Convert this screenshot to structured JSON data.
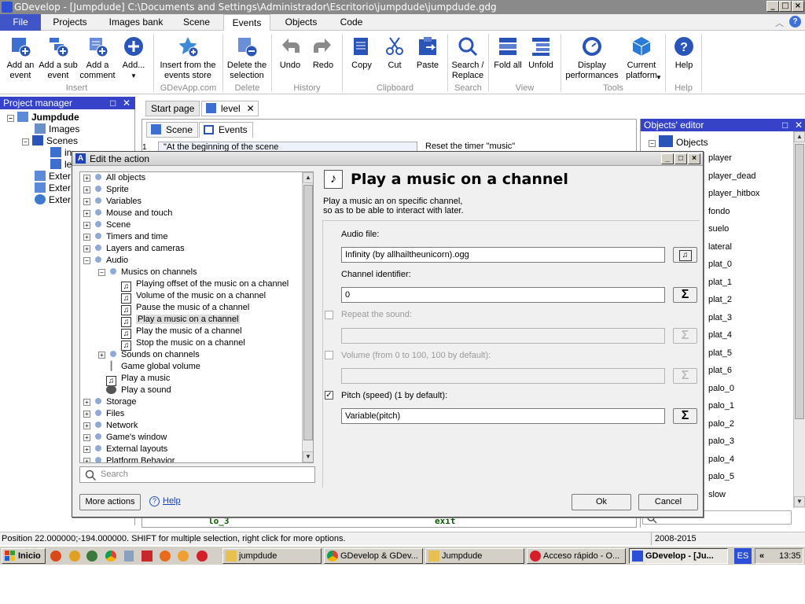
{
  "window": {
    "title": "GDevelop - [Jumpdude] C:\\Documents and Settings\\Administrador\\Escritorio\\jumpdude\\jumpdude.gdg"
  },
  "ribbon_tabs": [
    "File",
    "Projects",
    "Images bank",
    "Scene",
    "Events",
    "Objects",
    "Code"
  ],
  "ribbon": {
    "buttons": [
      {
        "label": "Add an\nevent",
        "icon": "add-event-icon"
      },
      {
        "label": "Add a sub\nevent",
        "icon": "add-subevent-icon"
      },
      {
        "label": "Add a\ncomment",
        "icon": "add-comment-icon"
      },
      {
        "label": "Add...",
        "icon": "add-plus-icon"
      },
      {
        "label": "Insert from the\nevents store",
        "icon": "events-store-icon"
      },
      {
        "label": "Delete the\nselection",
        "icon": "delete-selection-icon"
      },
      {
        "label": "Undo",
        "icon": "undo-icon"
      },
      {
        "label": "Redo",
        "icon": "redo-icon"
      },
      {
        "label": "Copy",
        "icon": "copy-icon"
      },
      {
        "label": "Cut",
        "icon": "cut-icon"
      },
      {
        "label": "Paste",
        "icon": "paste-icon"
      },
      {
        "label": "Search /\nReplace",
        "icon": "search-icon"
      },
      {
        "label": "Fold all",
        "icon": "fold-all-icon"
      },
      {
        "label": "Unfold",
        "icon": "unfold-icon"
      },
      {
        "label": "Display\nperformances",
        "icon": "performance-icon"
      },
      {
        "label": "Current\nplatform",
        "icon": "platform-icon"
      },
      {
        "label": "Help",
        "icon": "help-icon"
      }
    ],
    "groups": [
      "Insert",
      "GDevApp.com",
      "Delete",
      "History",
      "Clipboard",
      "Search",
      "View",
      "Tools",
      "Help"
    ]
  },
  "project_manager": {
    "title": "Project manager",
    "tree": [
      "Jumpdude",
      "Images",
      "Scenes",
      "in",
      "le",
      "Exter",
      "Exter",
      "Exter"
    ]
  },
  "editor_tabs": [
    "Start page",
    "level"
  ],
  "sub_tabs": [
    "Scene",
    "Events"
  ],
  "events_fragments": [
    "1",
    "\"At the beginning of the scene",
    "Reset the timer \"music\"",
    "lo_3",
    "exit"
  ],
  "objects_editor": {
    "title": "Objects' editor",
    "root": "Objects",
    "items": [
      "player",
      "player_dead",
      "player_hitbox",
      "fondo",
      "suelo",
      "lateral",
      "plat_0",
      "plat_1",
      "plat_2",
      "plat_3",
      "plat_4",
      "plat_5",
      "plat_6",
      "palo_0",
      "palo_1",
      "palo_2",
      "palo_3",
      "palo_4",
      "palo_5",
      "slow"
    ]
  },
  "dialog": {
    "title": "Edit the action",
    "action_title": "Play a music on a channel",
    "description": "Play a music an on specific channel,\nso as to be able to interact with later.",
    "tree": [
      "All objects",
      "Sprite",
      "Variables",
      "Mouse and touch",
      "Scene",
      "Timers and time",
      "Layers and cameras",
      "Audio",
      "Musics on channels",
      "Playing offset of the music on a channel",
      "Volume of the music on a channel",
      "Pause the music of a channel",
      "Play a music on a channel",
      "Play the music of a channel",
      "Stop the music on a channel",
      "Sounds on channels",
      "Game global volume",
      "Play a music",
      "Play a sound",
      "Storage",
      "Files",
      "Network",
      "Game's window",
      "External layouts",
      "Platform Behavior"
    ],
    "search_placeholder": "Search",
    "fields": {
      "audio_label": "Audio file:",
      "audio_value": "Infinity (by allhailtheunicorn).ogg",
      "channel_label": "Channel identifier:",
      "channel_value": "0",
      "repeat_label": "Repeat the sound:",
      "volume_label": "Volume (from 0 to 100, 100 by default):",
      "pitch_label": "Pitch (speed) (1 by default):",
      "pitch_value": "Variable(pitch)"
    },
    "buttons": {
      "more": "More actions",
      "help": "Help",
      "ok": "Ok",
      "cancel": "Cancel"
    }
  },
  "status": {
    "text": "Position 22.000000;-194.000000. SHIFT for multiple selection, right click for more options.",
    "years": "2008-2015"
  },
  "taskbar": {
    "start": "Inicio",
    "tasks": [
      "jumpdude",
      "GDevelop & GDev...",
      "Jumpdude",
      "Acceso rápido - O...",
      "GDevelop - [Ju..."
    ],
    "lang": "ES",
    "time": "13:35"
  },
  "colors": {
    "accent": "#3643c9",
    "file_tab": "#3f55c8",
    "title_inactive": "#8a8a8a"
  }
}
